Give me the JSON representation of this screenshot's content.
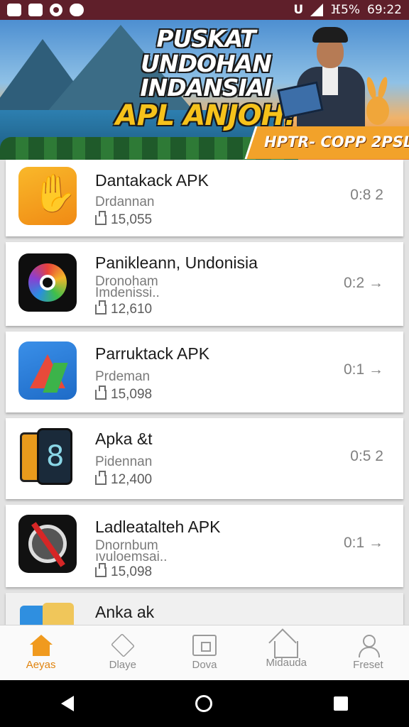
{
  "status_bar": {
    "time": "69:22",
    "battery": "ⴼ5%"
  },
  "banner": {
    "title_line1": "PUSKAT UNDOHAN",
    "title_line2": "INDANSIAI",
    "title_line3": "APL ANJOH!",
    "ribbon": "HPTR- COPP 2PSL!"
  },
  "apps": [
    {
      "name": "Dantakack APK",
      "sub": "Drdannan",
      "sub2": "",
      "downloads": "15,055",
      "meta": "0:8 2",
      "icon": "hand-icon"
    },
    {
      "name": "Panikleann, Undonisia",
      "sub": "Dronoham",
      "sub2": "Imdenissi..",
      "downloads": "12,610",
      "meta": "0:2 →",
      "icon": "swirl-icon"
    },
    {
      "name": "Parruktack APK",
      "sub": "Prdeman",
      "sub2": "",
      "downloads": "15,098",
      "meta": "0:1 →",
      "icon": "arrow-icon"
    },
    {
      "name": "Apka &t",
      "sub": "Pidennan",
      "sub2": "",
      "downloads": "12,400",
      "meta": "0:5 2",
      "icon": "phone-icon"
    },
    {
      "name": "Ladleatalteh APK",
      "sub": "Dnornbum",
      "sub2": "ıvuloemsai..",
      "downloads": "15,098",
      "meta": "0:1 →",
      "icon": "speaker-icon"
    },
    {
      "name": "Anka ak",
      "sub": "",
      "sub2": "",
      "downloads": "",
      "meta": "",
      "icon": "cards-icon"
    }
  ],
  "nav": [
    {
      "label": "Aeyas",
      "icon": "home-icon",
      "active": true
    },
    {
      "label": "Dlaye",
      "icon": "tag-icon",
      "active": false
    },
    {
      "label": "Dova",
      "icon": "box-icon",
      "active": false
    },
    {
      "label": "Midauda",
      "icon": "house-icon",
      "active": false
    },
    {
      "label": "Freset",
      "icon": "user-icon",
      "active": false
    }
  ],
  "colors": {
    "accent": "#f09a1e",
    "statusbar": "#5f1f2a",
    "ribbon": "#f2a22a"
  }
}
